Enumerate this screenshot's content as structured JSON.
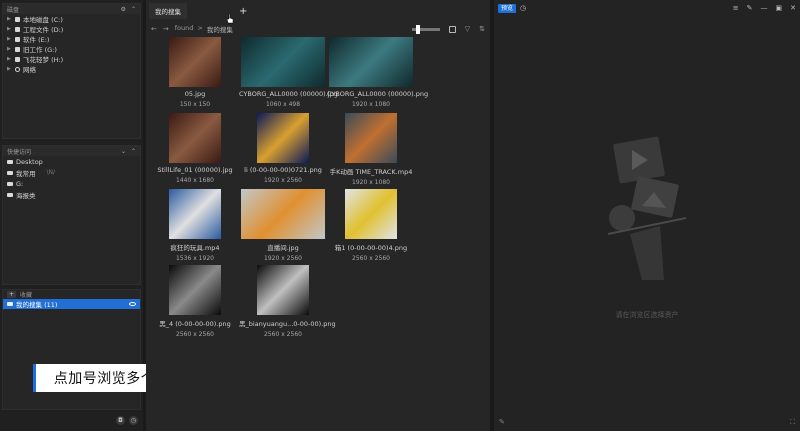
{
  "disk_panel": {
    "title": "磁盘",
    "items": [
      {
        "label": "本地磁盘 (C:)",
        "icon": "drive-icon"
      },
      {
        "label": "工程文件 (D:)",
        "icon": "drive-icon"
      },
      {
        "label": "软件 (E:)",
        "icon": "drive-icon"
      },
      {
        "label": "旧工作 (G:)",
        "icon": "drive-icon"
      },
      {
        "label": "飞花轻梦 (H:)",
        "icon": "drive-icon"
      },
      {
        "label": "网络",
        "icon": "globe-icon"
      }
    ]
  },
  "quick_panel": {
    "title": "快捷访问",
    "items": [
      {
        "label": "Desktop",
        "path": ""
      },
      {
        "label": "我常用",
        "path": "\\N/"
      },
      {
        "label": "G:",
        "path": ""
      },
      {
        "label": "海报类",
        "path": ""
      }
    ]
  },
  "fav_panel": {
    "add": "+",
    "title": "收藏",
    "item": "我的搜集 (11)"
  },
  "caption": "点加号浏览多个文件",
  "tab": {
    "label": "我的搜集",
    "add": "+"
  },
  "toolbar": {
    "back": "←",
    "forward": "→",
    "crumbs": [
      "found",
      ">",
      "我的搜集"
    ]
  },
  "files": [
    {
      "name": "05.jpg",
      "dim": "150 x 150",
      "color1": "#3a1a14",
      "color2": "#8a5a40"
    },
    {
      "name": "CYBORG_ALL0000 (00000).jpg",
      "dim": "1060 x 498",
      "color1": "#0f2a2e",
      "color2": "#2a6a70"
    },
    {
      "name": "CYBORG_ALL0000 (00000).png",
      "dim": "1920 x 1080",
      "color1": "#10282c",
      "color2": "#3c7a80"
    },
    {
      "name": "StillLife_01 (00000).jpg",
      "dim": "1440 x 1680",
      "color1": "#3a1a14",
      "color2": "#8a5a40"
    },
    {
      "name": "li (0-00-00-00)0721.png",
      "dim": "1920 x 2560",
      "color1": "#0a1a5a",
      "color2": "#d9a030"
    },
    {
      "name": "手K动画 TIME_TRACK.mp4",
      "dim": "1920 x 1080",
      "color1": "#3a4a5a",
      "color2": "#c07030"
    },
    {
      "name": "疯狂的玩具.mp4",
      "dim": "1536 x 1920",
      "color1": "#2a5aa0",
      "color2": "#e0e0e0"
    },
    {
      "name": "直播间.jpg",
      "dim": "1920 x 2560",
      "color1": "#c0c8c8",
      "color2": "#e09030"
    },
    {
      "name": "箱1 (0-00-00-00)4.png",
      "dim": "2560 x 2560",
      "color1": "#e0e4e8",
      "color2": "#e0c030"
    },
    {
      "name": "黑_4 (0-00-00-00).png",
      "dim": "2560 x 2560",
      "color1": "#0a0a0a",
      "color2": "#8a8a8a"
    },
    {
      "name": "黑_bianyuangu...0-00-00).png",
      "dim": "2560 x 2560",
      "color1": "#0a0a0a",
      "color2": "#c0c0c0"
    }
  ],
  "right_panel": {
    "preview_label": "预览",
    "empty_text": "请在浏览区选择资产"
  }
}
